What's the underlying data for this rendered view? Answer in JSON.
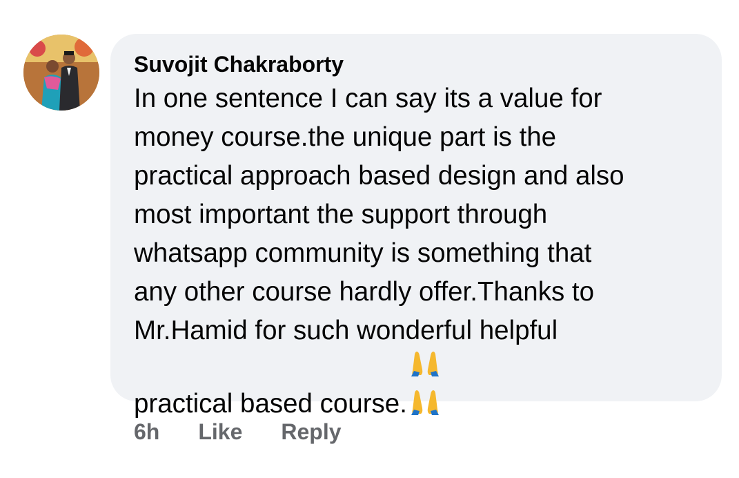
{
  "comment": {
    "author": "Suvojit Chakraborty",
    "text": "In one sentence I can say its a value for\nmoney course.the unique part is the\npractical approach based design and also\nmost important the support through\nwhatsapp community is something that\nany other course hardly offer.Thanks to\nMr.Hamid for such wonderful helpful\npractical based course.",
    "emojis": [
      "folded-hands-icon",
      "folded-hands-icon"
    ]
  },
  "actions": {
    "timestamp": "6h",
    "like_label": "Like",
    "reply_label": "Reply"
  },
  "colors": {
    "bubble_bg": "#f0f2f5",
    "text": "#050505",
    "secondary_text": "#65676b"
  }
}
